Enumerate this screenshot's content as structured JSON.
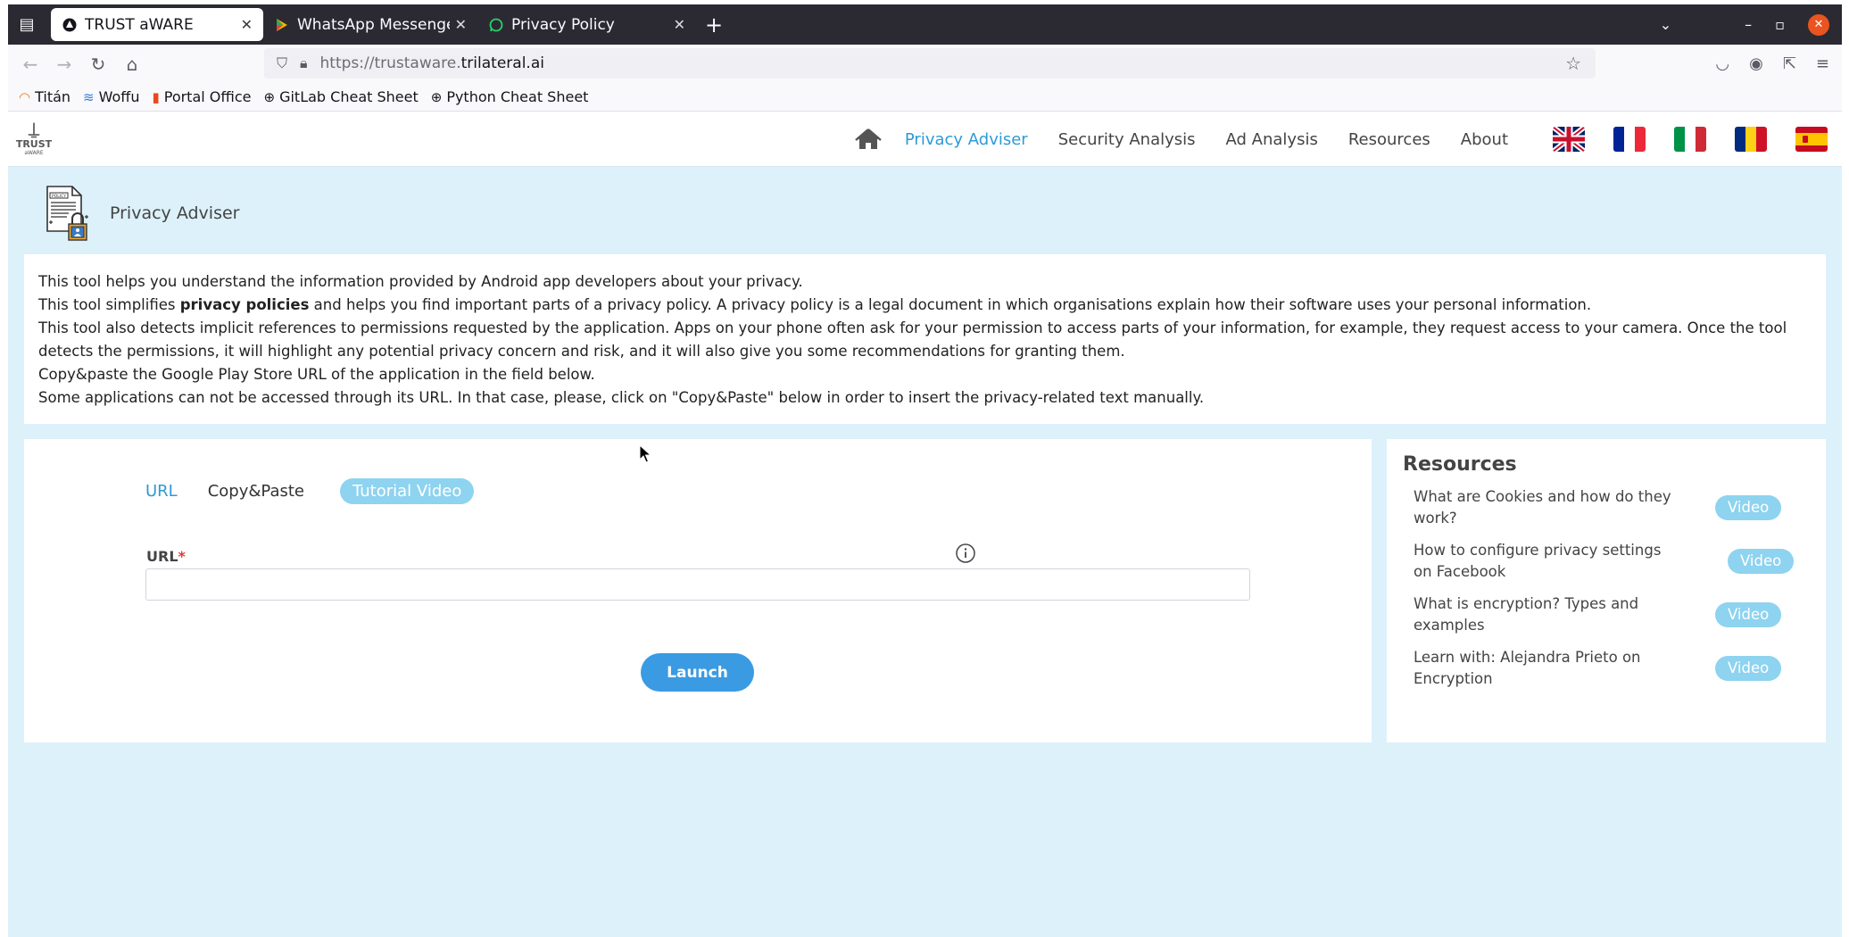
{
  "browser": {
    "tabs": [
      {
        "title": "TRUST aWARE",
        "active": true
      },
      {
        "title": "WhatsApp Messenger - A"
      },
      {
        "title": "Privacy Policy"
      }
    ],
    "url_scheme": "https://trustaware.",
    "url_host": "trilateral.ai",
    "bookmarks": [
      "Titán",
      "Woffu",
      "Portal Office",
      "GitLab Cheat Sheet",
      "Python Cheat Sheet"
    ]
  },
  "header": {
    "logo_text": "TRUST",
    "logo_sub": "aWARE",
    "nav": [
      "Privacy Adviser",
      "Security Analysis",
      "Ad Analysis",
      "Resources",
      "About"
    ]
  },
  "page_title": "Privacy Adviser",
  "intro": {
    "line1": "This tool helps you understand the information provided by Android app developers about your privacy.",
    "line2_pre": "This tool simplifies ",
    "line2_bold": "privacy policies",
    "line2_post": " and helps you find important parts of a privacy policy. A privacy policy is a legal document in which organisations explain how their software uses your personal information.",
    "line3": "This tool also detects implicit references to permissions requested by the application. Apps on your phone often ask for your permission to access parts of your information, for example, they request access to your camera. Once the tool detects the permissions, it will highlight any potential privacy concern and risk, and it will also give you some recommendations for granting them.",
    "line4": "Copy&paste the Google Play Store URL of the application in the field below.",
    "line5": "Some applications can not be accessed through its URL. In that case, please, click on \"Copy&Paste\" below in order to insert the privacy-related text manually."
  },
  "tool": {
    "tabs": [
      "URL",
      "Copy&Paste"
    ],
    "tutorial_label": "Tutorial Video",
    "url_label": "URL",
    "required_mark": "*",
    "url_value": "",
    "launch_label": "Launch"
  },
  "resources": {
    "title": "Resources",
    "video_label": "Video",
    "items": [
      "What are Cookies and how do they work?",
      "How to configure privacy settings on Facebook",
      "What is encryption? Types and examples",
      "Learn with: Alejandra Prieto on Encryption"
    ]
  },
  "colors": {
    "accent": "#2d9ad8",
    "page_bg": "#ddf1fb",
    "pill": "#8ed3ef",
    "launch": "#3a9be3"
  }
}
